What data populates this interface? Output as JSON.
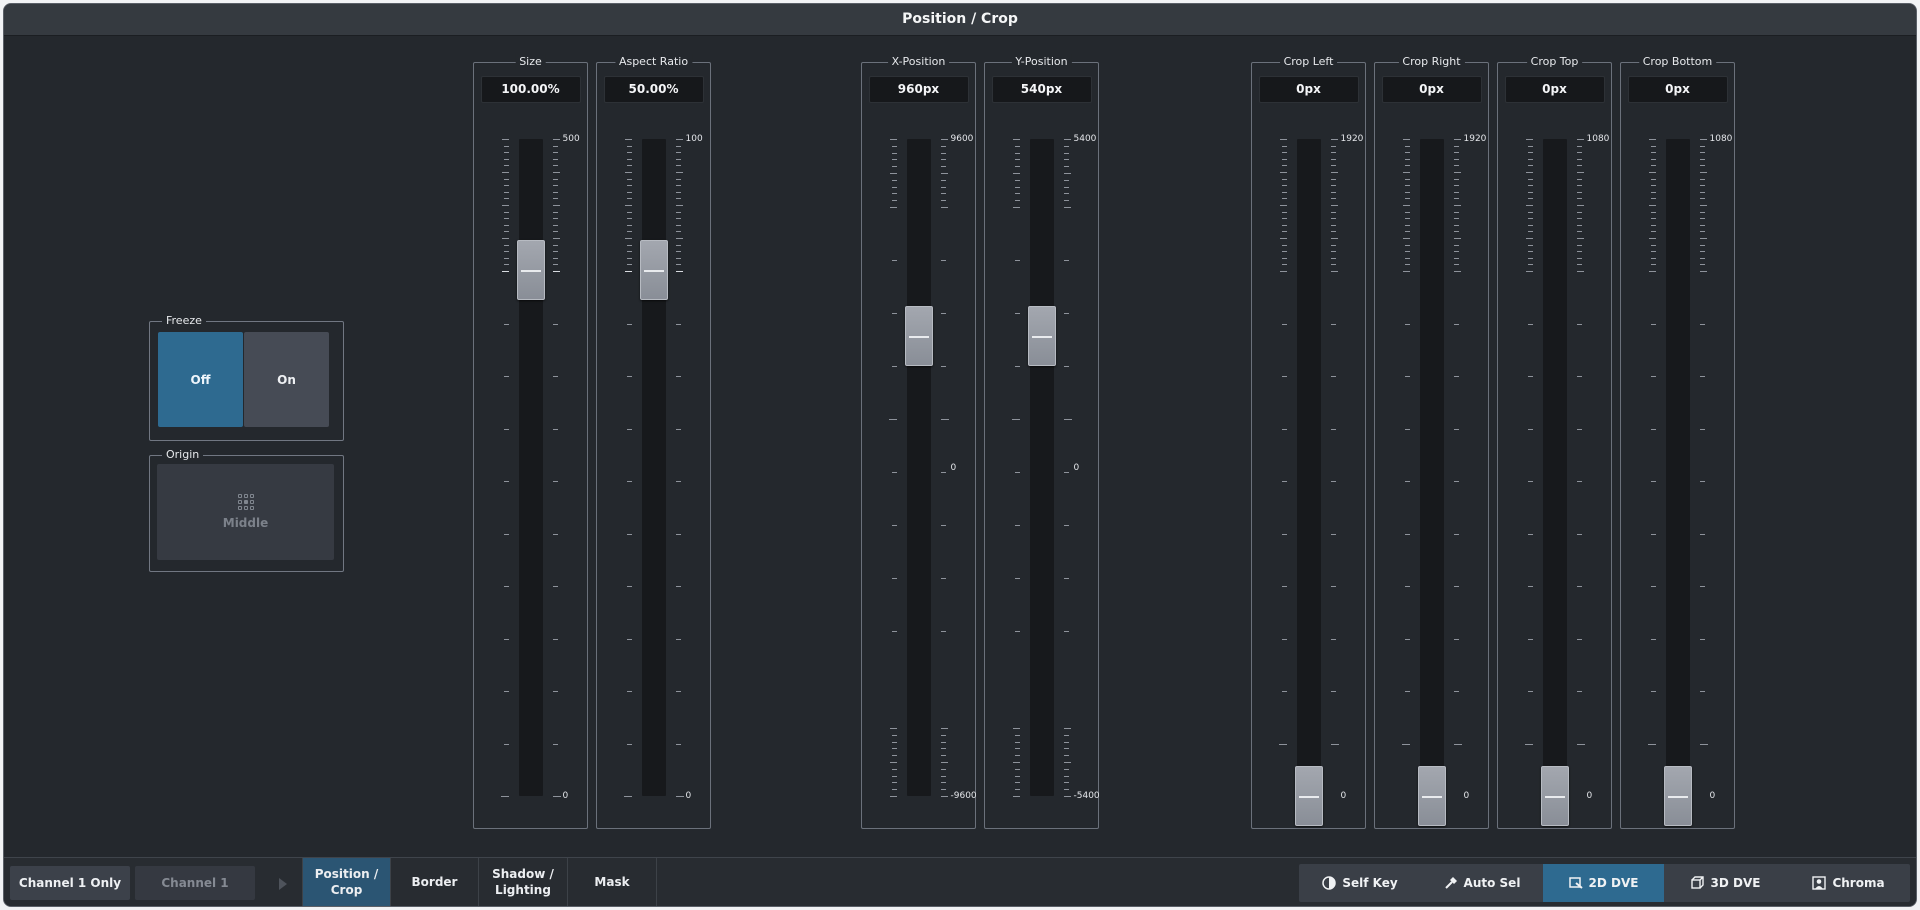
{
  "window": {
    "title": "Position / Crop"
  },
  "freeze": {
    "label": "Freeze",
    "off_label": "Off",
    "on_label": "On",
    "selected": "Off"
  },
  "origin": {
    "label": "Origin",
    "value": "Middle"
  },
  "faders": [
    {
      "label": "Size",
      "value": "100.00%",
      "max": "500",
      "min": "0",
      "level": 0.8
    },
    {
      "label": "Aspect Ratio",
      "value": "50.00%",
      "max": "100",
      "min": "0",
      "level": 0.8
    },
    {
      "label": "X-Position",
      "value": "960px",
      "max": "9600",
      "mid": "0",
      "min": "-9600",
      "level": 0.7
    },
    {
      "label": "Y-Position",
      "value": "540px",
      "max": "5400",
      "mid": "0",
      "min": "-5400",
      "level": 0.7
    },
    {
      "label": "Crop Left",
      "value": "0px",
      "max": "1920",
      "min": "0",
      "level": 0.0
    },
    {
      "label": "Crop Right",
      "value": "0px",
      "max": "1920",
      "min": "0",
      "level": 0.0
    },
    {
      "label": "Crop Top",
      "value": "0px",
      "max": "1080",
      "min": "0",
      "level": 0.0
    },
    {
      "label": "Crop Bottom",
      "value": "0px",
      "max": "1080",
      "min": "0",
      "level": 0.0
    }
  ],
  "bottom": {
    "channel_only": "Channel 1 Only",
    "channel": "Channel 1",
    "tabs": [
      {
        "label": "Position /\nCrop",
        "active": true
      },
      {
        "label": "Border",
        "active": false
      },
      {
        "label": "Shadow /\nLighting",
        "active": false
      },
      {
        "label": "Mask",
        "active": false
      }
    ],
    "modes": [
      {
        "label": "Self Key",
        "icon": "self-key-icon",
        "active": false
      },
      {
        "label": "Auto Sel",
        "icon": "auto-select-icon",
        "active": false
      },
      {
        "label": "2D DVE",
        "icon": "2d-dve-icon",
        "active": true
      },
      {
        "label": "3D DVE",
        "icon": "3d-dve-icon",
        "active": false
      },
      {
        "label": "Chroma",
        "icon": "chroma-icon",
        "active": false
      }
    ]
  },
  "colors": {
    "background": "#24282d",
    "accent": "#2e6a90",
    "button": "#464b55"
  }
}
